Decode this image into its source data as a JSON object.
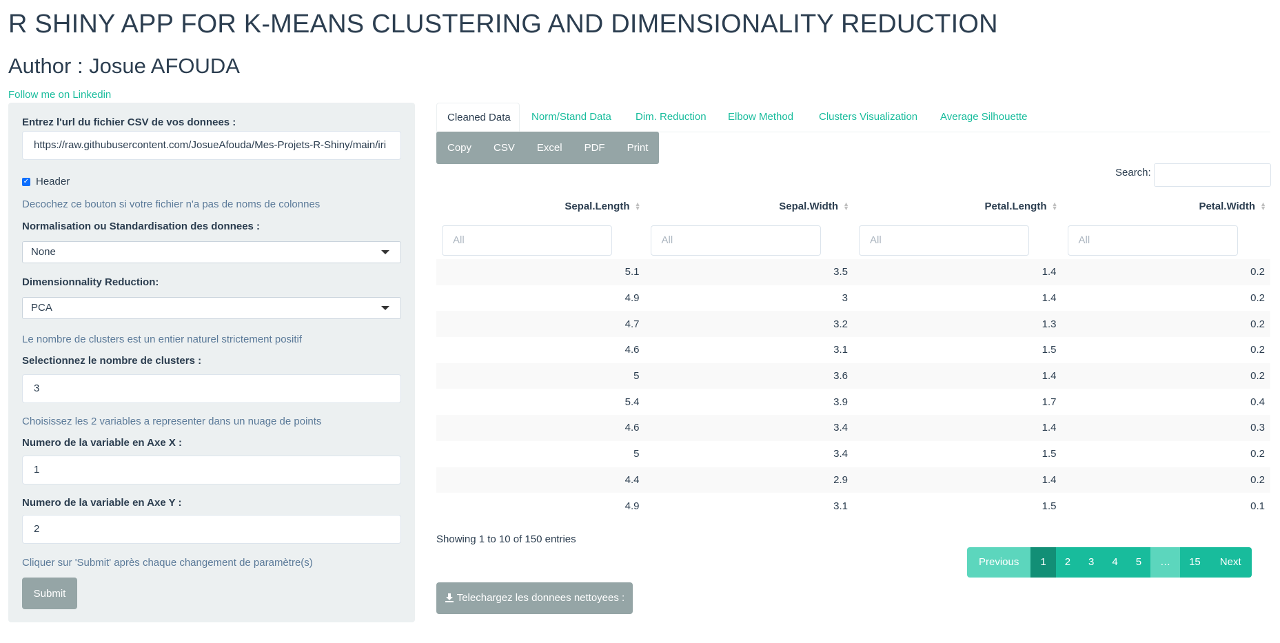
{
  "title": "R SHINY APP FOR K-MEANS CLUSTERING AND DIMENSIONALITY REDUCTION",
  "author": "Author : Josue AFOUDA",
  "follow_link": "Follow me on Linkedin",
  "sidebar": {
    "url_label": "Entrez l'url du fichier CSV de vos donnees :",
    "url_value": "https://raw.githubusercontent.com/JosueAfouda/Mes-Projets-R-Shiny/main/iri",
    "header_label": "Header",
    "header_checked": true,
    "header_help": "Decochez ce bouton si votre fichier n'a pas de noms de colonnes",
    "norm_label": "Normalisation ou Standardisation des donnees :",
    "norm_value": "None",
    "dim_label": "Dimensionnality Reduction:",
    "dim_value": "PCA",
    "clusters_help": "Le nombre de clusters est un entier naturel strictement positif",
    "clusters_label": "Selectionnez le nombre de clusters :",
    "clusters_value": "3",
    "vars_help": "Choisissez les 2 variables a representer dans un nuage de points",
    "x_label": "Numero de la variable en Axe X :",
    "x_value": "1",
    "y_label": "Numero de la variable en Axe Y :",
    "y_value": "2",
    "submit_help": "Cliquer sur 'Submit' après chaque changement de paramètre(s)",
    "submit_label": "Submit"
  },
  "tabs": [
    "Cleaned Data",
    "Norm/Stand Data",
    "Dim. Reduction",
    "Elbow Method",
    "Clusters Visualization",
    "Average Silhouette"
  ],
  "export_buttons": [
    "Copy",
    "CSV",
    "Excel",
    "PDF",
    "Print"
  ],
  "search_label": "Search:",
  "table": {
    "columns": [
      "Sepal.Length",
      "Sepal.Width",
      "Petal.Length",
      "Petal.Width"
    ],
    "filter_placeholder": "All",
    "rows": [
      [
        "5.1",
        "3.5",
        "1.4",
        "0.2"
      ],
      [
        "4.9",
        "3",
        "1.4",
        "0.2"
      ],
      [
        "4.7",
        "3.2",
        "1.3",
        "0.2"
      ],
      [
        "4.6",
        "3.1",
        "1.5",
        "0.2"
      ],
      [
        "5",
        "3.6",
        "1.4",
        "0.2"
      ],
      [
        "5.4",
        "3.9",
        "1.7",
        "0.4"
      ],
      [
        "4.6",
        "3.4",
        "1.4",
        "0.3"
      ],
      [
        "5",
        "3.4",
        "1.5",
        "0.2"
      ],
      [
        "4.4",
        "2.9",
        "1.4",
        "0.2"
      ],
      [
        "4.9",
        "3.1",
        "1.5",
        "0.1"
      ]
    ]
  },
  "info": "Showing 1 to 10 of 150 entries",
  "pagination": {
    "previous": "Previous",
    "pages": [
      "1",
      "2",
      "3",
      "4",
      "5",
      "…",
      "15"
    ],
    "next": "Next",
    "current": "1"
  },
  "download_label": "Telechargez les donnees nettoyees :",
  "colors": {
    "primary": "#2c3e50",
    "accent": "#18bc9c",
    "muted_button": "#95a5a6",
    "sidebar_bg": "#ecf0f1"
  }
}
